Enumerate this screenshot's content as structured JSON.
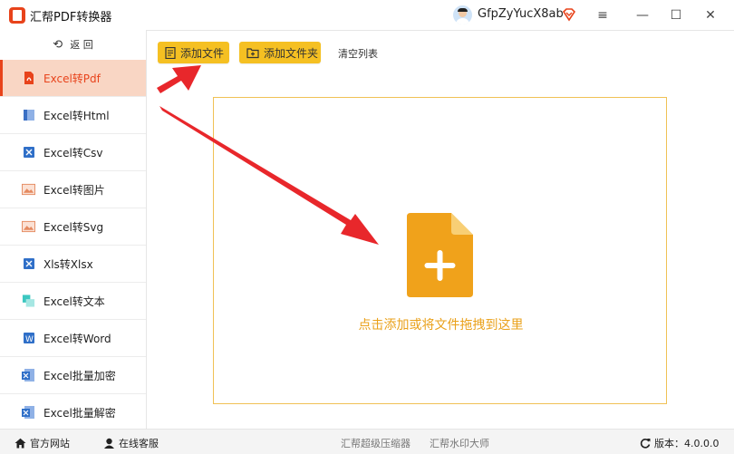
{
  "app": {
    "title": "汇帮PDF转换器",
    "brand_color": "#e8431b",
    "accent_color": "#f5c022"
  },
  "user": {
    "name": "GfpZyYucX8ab",
    "badge_icon": "vip-diamond-icon"
  },
  "window": {
    "menu_icon": "≡",
    "minimize_icon": "—",
    "maximize_icon": "☐",
    "close_icon": "✕"
  },
  "sidebar": {
    "back_label": "返  回",
    "items": [
      {
        "label": "Excel转Pdf",
        "icon": "pdf-icon",
        "active": true
      },
      {
        "label": "Excel转Html",
        "icon": "html-icon"
      },
      {
        "label": "Excel转Csv",
        "icon": "csv-icon"
      },
      {
        "label": "Excel转图片",
        "icon": "image-icon"
      },
      {
        "label": "Excel转Svg",
        "icon": "svg-image-icon"
      },
      {
        "label": "Xls转Xlsx",
        "icon": "xlsx-icon"
      },
      {
        "label": "Excel转文本",
        "icon": "text-icon"
      },
      {
        "label": "Excel转Word",
        "icon": "word-icon"
      },
      {
        "label": "Excel批量加密",
        "icon": "excel-lock-icon"
      },
      {
        "label": "Excel批量解密",
        "icon": "excel-unlock-icon"
      }
    ]
  },
  "toolbar": {
    "add_file": "添加文件",
    "add_folder": "添加文件夹",
    "clear_list": "清空列表"
  },
  "main": {
    "drop_text": "点击添加或将文件拖拽到这里"
  },
  "footer": {
    "website": "官方网站",
    "support": "在线客服",
    "link1": "汇帮超级压缩器",
    "link2": "汇帮水印大师",
    "version_label": "版本：",
    "version": "4.0.0.0"
  }
}
